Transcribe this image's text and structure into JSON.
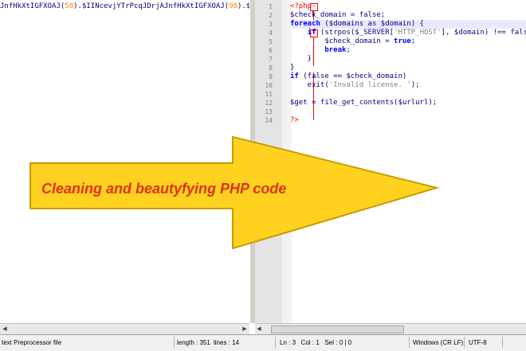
{
  "left_pane": {
    "code_parts": [
      {
        "t": "JnfHkXtIGFXOAJ(",
        "c": "var"
      },
      {
        "t": "58",
        "c": "num"
      },
      {
        "t": ").$IINcevjYTrPcqJDrjAJnfHkXtIGFXOAJ(",
        "c": "var"
      },
      {
        "t": "98",
        "c": "num"
      },
      {
        "t": ").$II",
        "c": "var"
      }
    ]
  },
  "right_pane": {
    "line_numbers": [
      "1",
      "2",
      "3",
      "4",
      "5",
      "6",
      "7",
      "8",
      "9",
      "10",
      "11",
      "12",
      "13",
      "14"
    ],
    "lines": [
      [
        {
          "t": "<?php",
          "c": "tag"
        }
      ],
      [
        {
          "t": "$check_domain = false;",
          "c": "var"
        }
      ],
      [
        {
          "t": "foreach",
          "c": "kw"
        },
        {
          "t": " ($domains as $domain) {",
          "c": "var"
        }
      ],
      [
        {
          "t": "    if",
          "c": "kw"
        },
        {
          "t": " (strpos($_SERVER[",
          "c": "var"
        },
        {
          "t": "'HTTP_HOST'",
          "c": "str"
        },
        {
          "t": "], $domain) !== false",
          "c": "var"
        }
      ],
      [
        {
          "t": "        $check_domain = ",
          "c": "var"
        },
        {
          "t": "true",
          "c": "kw"
        },
        {
          "t": ";",
          "c": "var"
        }
      ],
      [
        {
          "t": "        break",
          "c": "kw"
        },
        {
          "t": ";",
          "c": "var"
        }
      ],
      [
        {
          "t": "    }",
          "c": "var"
        }
      ],
      [
        {
          "t": "}",
          "c": "var"
        }
      ],
      [
        {
          "t": "if",
          "c": "kw"
        },
        {
          "t": " (false == $check_domain)",
          "c": "var"
        }
      ],
      [
        {
          "t": "    exit(",
          "c": "fn"
        },
        {
          "t": "'Invalid license. '",
          "c": "str"
        },
        {
          "t": ");",
          "c": "var"
        }
      ],
      [
        {
          "t": "",
          "c": "var"
        }
      ],
      [
        {
          "t": "$get = file_get_contents($urlurl);",
          "c": "var"
        }
      ],
      [
        {
          "t": "",
          "c": "var"
        }
      ],
      [
        {
          "t": "?>",
          "c": "tag"
        }
      ]
    ]
  },
  "banner": {
    "text": "Cleaning and beautyfying PHP code",
    "arrow_fill": "#ffd21f",
    "arrow_stroke": "#c89b00",
    "text_color": "#e03010"
  },
  "status": {
    "file_type": "text Preprocessor file",
    "length": "length : 351",
    "lines": "lines : 14",
    "position": "Ln : 3   Col : 1   Sel : 0 | 0",
    "eol": "Windows (CR LF)",
    "encoding": "UTF-8"
  }
}
